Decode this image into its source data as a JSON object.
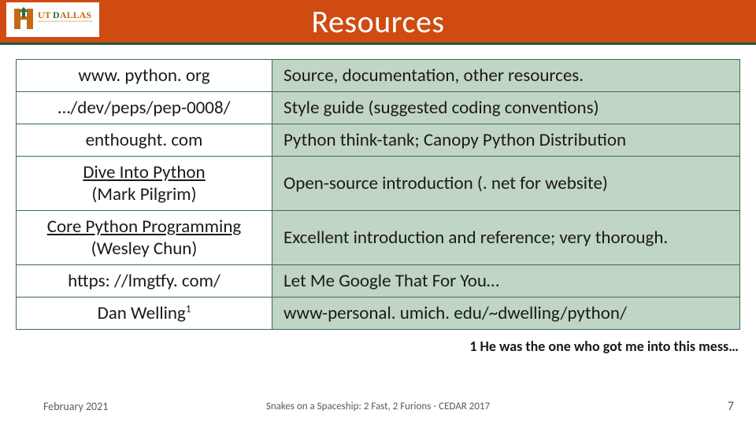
{
  "colors": {
    "header_bg": "#cf4b11",
    "underline": "#205a41",
    "row_odd_right": "#c0d5c3",
    "border": "#3b6b55"
  },
  "header": {
    "title": "Resources",
    "logo_text": "UT DALLAS"
  },
  "table": {
    "rows": [
      {
        "left_main": "www. python. org",
        "left_sub": "",
        "left_underline": false,
        "left_has_sup": false,
        "right": "Source, documentation, other resources."
      },
      {
        "left_main": "…/dev/peps/pep-0008/",
        "left_sub": "",
        "left_underline": false,
        "left_has_sup": false,
        "right": "Style guide (suggested coding conventions)"
      },
      {
        "left_main": "enthought. com",
        "left_sub": "",
        "left_underline": false,
        "left_has_sup": false,
        "right": "Python think-tank; Canopy Python Distribution"
      },
      {
        "left_main": "Dive Into Python",
        "left_sub": "(Mark Pilgrim)",
        "left_underline": true,
        "left_has_sup": false,
        "right": "Open-source introduction (. net for website)"
      },
      {
        "left_main": "Core Python Programming",
        "left_sub": "(Wesley Chun)",
        "left_underline": true,
        "left_has_sup": false,
        "right": "Excellent introduction and reference; very thorough."
      },
      {
        "left_main": "https: //lmgtfy. com/",
        "left_sub": "",
        "left_underline": false,
        "left_has_sup": false,
        "right": "Let Me Google That For You…"
      },
      {
        "left_main": "Dan Welling",
        "left_sub": "",
        "left_underline": false,
        "left_has_sup": true,
        "sup": "1",
        "right": "www-personal. umich. edu/~dwelling/python/"
      }
    ]
  },
  "footnote": "1 He was the one who got me into this mess…",
  "footer": {
    "left": "February 2021",
    "center": "Snakes on a Spaceship: 2 Fast, 2 Furions - CEDAR 2017",
    "right": "7"
  }
}
